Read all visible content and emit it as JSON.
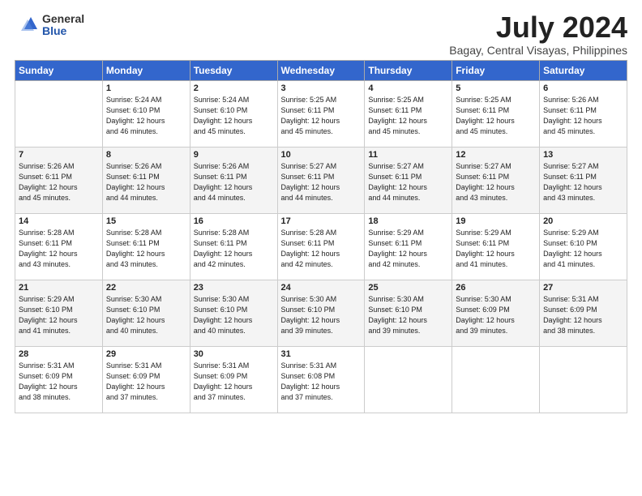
{
  "header": {
    "logo_general": "General",
    "logo_blue": "Blue",
    "title": "July 2024",
    "subtitle": "Bagay, Central Visayas, Philippines"
  },
  "days_of_week": [
    "Sunday",
    "Monday",
    "Tuesday",
    "Wednesday",
    "Thursday",
    "Friday",
    "Saturday"
  ],
  "weeks": [
    [
      {
        "num": "",
        "detail": ""
      },
      {
        "num": "1",
        "detail": "Sunrise: 5:24 AM\nSunset: 6:10 PM\nDaylight: 12 hours\nand 46 minutes."
      },
      {
        "num": "2",
        "detail": "Sunrise: 5:24 AM\nSunset: 6:10 PM\nDaylight: 12 hours\nand 45 minutes."
      },
      {
        "num": "3",
        "detail": "Sunrise: 5:25 AM\nSunset: 6:11 PM\nDaylight: 12 hours\nand 45 minutes."
      },
      {
        "num": "4",
        "detail": "Sunrise: 5:25 AM\nSunset: 6:11 PM\nDaylight: 12 hours\nand 45 minutes."
      },
      {
        "num": "5",
        "detail": "Sunrise: 5:25 AM\nSunset: 6:11 PM\nDaylight: 12 hours\nand 45 minutes."
      },
      {
        "num": "6",
        "detail": "Sunrise: 5:26 AM\nSunset: 6:11 PM\nDaylight: 12 hours\nand 45 minutes."
      }
    ],
    [
      {
        "num": "7",
        "detail": "Sunrise: 5:26 AM\nSunset: 6:11 PM\nDaylight: 12 hours\nand 45 minutes."
      },
      {
        "num": "8",
        "detail": "Sunrise: 5:26 AM\nSunset: 6:11 PM\nDaylight: 12 hours\nand 44 minutes."
      },
      {
        "num": "9",
        "detail": "Sunrise: 5:26 AM\nSunset: 6:11 PM\nDaylight: 12 hours\nand 44 minutes."
      },
      {
        "num": "10",
        "detail": "Sunrise: 5:27 AM\nSunset: 6:11 PM\nDaylight: 12 hours\nand 44 minutes."
      },
      {
        "num": "11",
        "detail": "Sunrise: 5:27 AM\nSunset: 6:11 PM\nDaylight: 12 hours\nand 44 minutes."
      },
      {
        "num": "12",
        "detail": "Sunrise: 5:27 AM\nSunset: 6:11 PM\nDaylight: 12 hours\nand 43 minutes."
      },
      {
        "num": "13",
        "detail": "Sunrise: 5:27 AM\nSunset: 6:11 PM\nDaylight: 12 hours\nand 43 minutes."
      }
    ],
    [
      {
        "num": "14",
        "detail": "Sunrise: 5:28 AM\nSunset: 6:11 PM\nDaylight: 12 hours\nand 43 minutes."
      },
      {
        "num": "15",
        "detail": "Sunrise: 5:28 AM\nSunset: 6:11 PM\nDaylight: 12 hours\nand 43 minutes."
      },
      {
        "num": "16",
        "detail": "Sunrise: 5:28 AM\nSunset: 6:11 PM\nDaylight: 12 hours\nand 42 minutes."
      },
      {
        "num": "17",
        "detail": "Sunrise: 5:28 AM\nSunset: 6:11 PM\nDaylight: 12 hours\nand 42 minutes."
      },
      {
        "num": "18",
        "detail": "Sunrise: 5:29 AM\nSunset: 6:11 PM\nDaylight: 12 hours\nand 42 minutes."
      },
      {
        "num": "19",
        "detail": "Sunrise: 5:29 AM\nSunset: 6:11 PM\nDaylight: 12 hours\nand 41 minutes."
      },
      {
        "num": "20",
        "detail": "Sunrise: 5:29 AM\nSunset: 6:10 PM\nDaylight: 12 hours\nand 41 minutes."
      }
    ],
    [
      {
        "num": "21",
        "detail": "Sunrise: 5:29 AM\nSunset: 6:10 PM\nDaylight: 12 hours\nand 41 minutes."
      },
      {
        "num": "22",
        "detail": "Sunrise: 5:30 AM\nSunset: 6:10 PM\nDaylight: 12 hours\nand 40 minutes."
      },
      {
        "num": "23",
        "detail": "Sunrise: 5:30 AM\nSunset: 6:10 PM\nDaylight: 12 hours\nand 40 minutes."
      },
      {
        "num": "24",
        "detail": "Sunrise: 5:30 AM\nSunset: 6:10 PM\nDaylight: 12 hours\nand 39 minutes."
      },
      {
        "num": "25",
        "detail": "Sunrise: 5:30 AM\nSunset: 6:10 PM\nDaylight: 12 hours\nand 39 minutes."
      },
      {
        "num": "26",
        "detail": "Sunrise: 5:30 AM\nSunset: 6:09 PM\nDaylight: 12 hours\nand 39 minutes."
      },
      {
        "num": "27",
        "detail": "Sunrise: 5:31 AM\nSunset: 6:09 PM\nDaylight: 12 hours\nand 38 minutes."
      }
    ],
    [
      {
        "num": "28",
        "detail": "Sunrise: 5:31 AM\nSunset: 6:09 PM\nDaylight: 12 hours\nand 38 minutes."
      },
      {
        "num": "29",
        "detail": "Sunrise: 5:31 AM\nSunset: 6:09 PM\nDaylight: 12 hours\nand 37 minutes."
      },
      {
        "num": "30",
        "detail": "Sunrise: 5:31 AM\nSunset: 6:09 PM\nDaylight: 12 hours\nand 37 minutes."
      },
      {
        "num": "31",
        "detail": "Sunrise: 5:31 AM\nSunset: 6:08 PM\nDaylight: 12 hours\nand 37 minutes."
      },
      {
        "num": "",
        "detail": ""
      },
      {
        "num": "",
        "detail": ""
      },
      {
        "num": "",
        "detail": ""
      }
    ]
  ]
}
